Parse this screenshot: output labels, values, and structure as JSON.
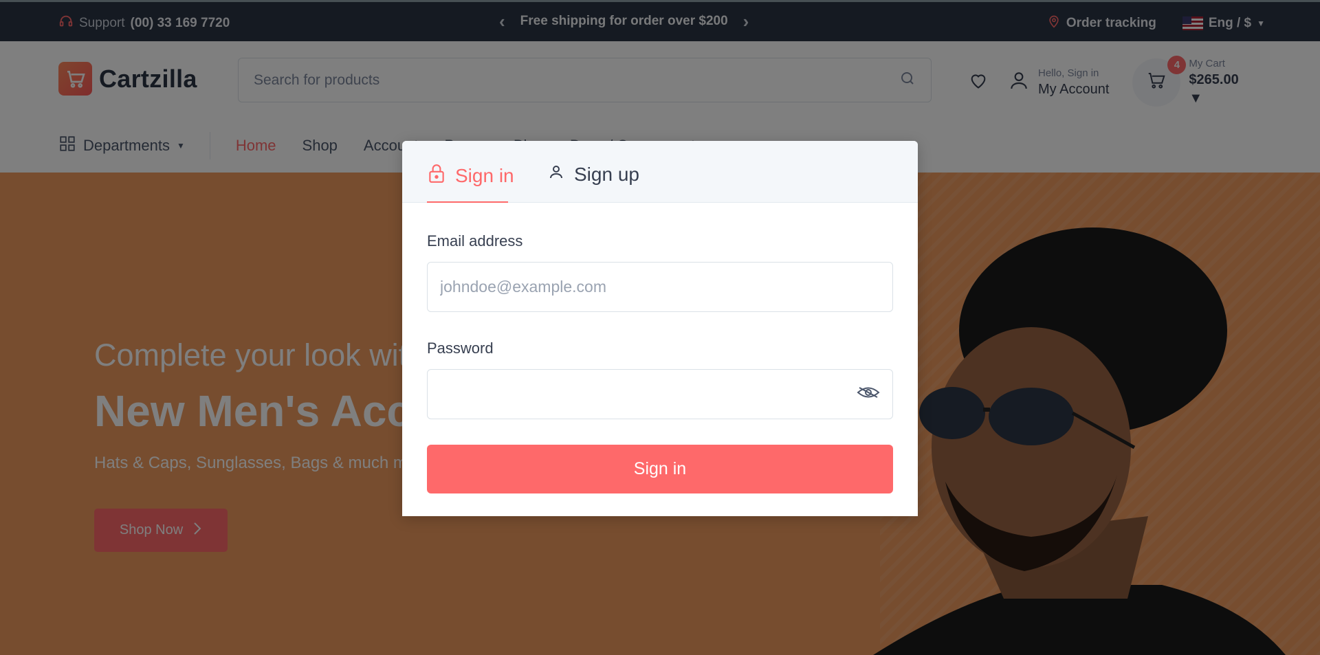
{
  "topbar": {
    "support_label": "Support",
    "support_phone": "(00) 33 169 7720",
    "promo_text": "Free shipping for order over $200",
    "order_tracking": "Order tracking",
    "language_currency": "Eng / $"
  },
  "header": {
    "brand": "Cartzilla",
    "search_placeholder": "Search for products",
    "account_greeting": "Hello, Sign in",
    "account_label": "My Account",
    "cart_label": "My Cart",
    "cart_total": "$265.00",
    "cart_count": "4"
  },
  "nav": {
    "departments": "Departments",
    "links": [
      "Home",
      "Shop",
      "Account",
      "Pages",
      "Blog",
      "Docs / Components"
    ]
  },
  "hero": {
    "subtitle": "Complete your look with",
    "title": "New Men's Accessories",
    "description": "Hats & Caps, Sunglasses, Bags & much more...",
    "button": "Shop Now"
  },
  "modal": {
    "tab_signin": "Sign in",
    "tab_signup": "Sign up",
    "email_label": "Email address",
    "email_placeholder": "johndoe@example.com",
    "password_label": "Password",
    "submit_label": "Sign in"
  },
  "colors": {
    "accent": "#fe696a",
    "topbar": "#2b3445",
    "hero_bg": "#ee9a5f"
  }
}
